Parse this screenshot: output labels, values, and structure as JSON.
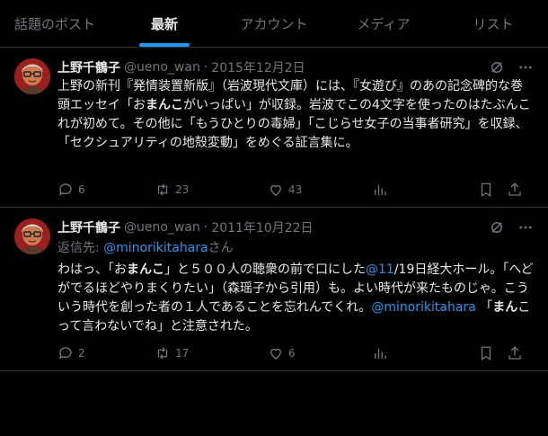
{
  "tabs": [
    {
      "label": "話題のポスト"
    },
    {
      "label": "最新"
    },
    {
      "label": "アカウント"
    },
    {
      "label": "メディア"
    },
    {
      "label": "リスト"
    }
  ],
  "posts": [
    {
      "author": "上野千鶴子",
      "handle": "@ueno_wan",
      "separator": "·",
      "date": "2015年12月2日",
      "text_parts": {
        "p1": "上野の新刊『発情装置新版』（岩波現代文庫）には、『女遊び』のあの記念碑的な巻頭エッセイ「お",
        "b1": "まんこ",
        "p2": "がいっぱい」が収録。岩波でこの4文字を使ったのはたぶんこれが初めて。その他に「もうひとりの毒婦」「こじらせ女子の当事者研究」を収録、「セクシュアリティの地殻変動」をめぐる証言集に。"
      },
      "stats": {
        "replies": "6",
        "reposts": "23",
        "likes": "43"
      }
    },
    {
      "author": "上野千鶴子",
      "handle": "@ueno_wan",
      "separator": "·",
      "date": "2011年10月22日",
      "replying_prefix": "返信先: ",
      "replying_mention": "@minorikitahara",
      "replying_suffix": "さん",
      "text_parts": {
        "p1": "わはっ、「お",
        "b1": "まんこ",
        "p2": "」と５００人の聴衆の前で口にした",
        "link1": "@11",
        "p3": "/19日経大ホール。「へどがでるほどやりまくりたい」（森瑶子から引用）も。よい時代が来たものじゃ。こういう時代を創った者の１人であることを忘れんでくれ。",
        "link2": "@minorikitahara",
        "p4": " 「",
        "b2": "まん",
        "p5": "こって言わないでね」と注意された。"
      },
      "stats": {
        "replies": "2",
        "reposts": "17",
        "likes": "6"
      }
    }
  ],
  "colors": {
    "accent": "#1d9bf0",
    "muted": "#71767b",
    "text": "#e7e9ea",
    "border": "#2f3336"
  }
}
